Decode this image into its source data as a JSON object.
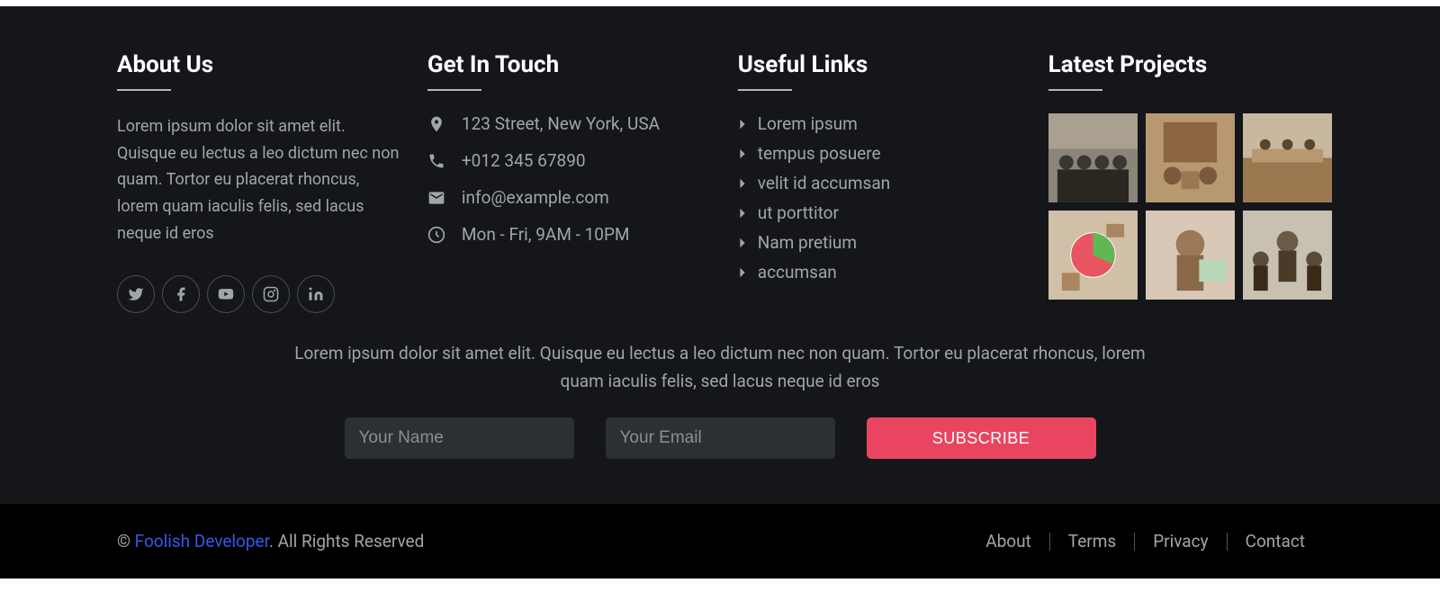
{
  "about": {
    "heading": "About Us",
    "text": "Lorem ipsum dolor sit amet elit. Quisque eu lectus a leo dictum nec non quam. Tortor eu placerat rhoncus, lorem quam iaculis felis, sed lacus neque id eros"
  },
  "social": {
    "twitter": "twitter-icon",
    "facebook": "facebook-icon",
    "youtube": "youtube-icon",
    "instagram": "instagram-icon",
    "linkedin": "linkedin-icon"
  },
  "touch": {
    "heading": "Get In Touch",
    "address": "123 Street, New York, USA",
    "phone": "+012 345 67890",
    "email": "info@example.com",
    "hours": "Mon - Fri, 9AM - 10PM"
  },
  "links": {
    "heading": "Useful Links",
    "items": [
      "Lorem ipsum",
      "tempus posuere",
      "velit id accumsan",
      "ut porttitor",
      "Nam pretium",
      "accumsan"
    ]
  },
  "projects": {
    "heading": "Latest Projects"
  },
  "newsletter": {
    "text": "Lorem ipsum dolor sit amet elit. Quisque eu lectus a leo dictum nec non quam. Tortor eu placerat rhoncus, lorem quam iaculis felis, sed lacus neque id eros",
    "name_placeholder": "Your Name",
    "email_placeholder": "Your Email",
    "button": "SUBSCRIBE"
  },
  "copyright": {
    "symbol": "© ",
    "link": "Foolish Developer",
    "rest": ". All Rights Reserved"
  },
  "bottom_nav": {
    "about": "About",
    "terms": "Terms",
    "privacy": "Privacy",
    "contact": "Contact"
  }
}
